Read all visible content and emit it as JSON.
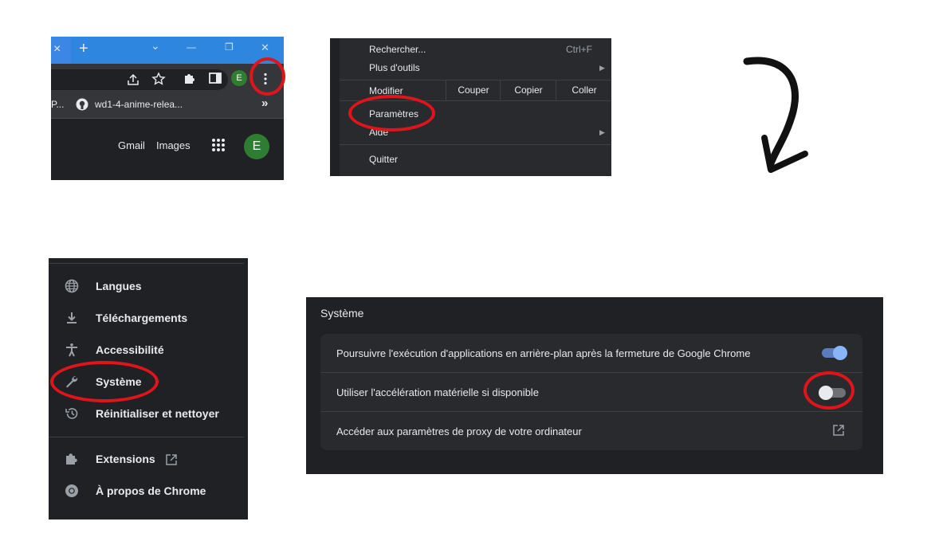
{
  "browser": {
    "tab_close": "×",
    "new_tab": "+",
    "tab_search": "⌄",
    "win_min": "—",
    "win_restore": "❐",
    "win_close": "✕",
    "profile_initial": "E",
    "bookmark_prev": "P...",
    "bookmark_label": "wd1-4-anime-relea...",
    "bookmarks_more": "»",
    "gmail": "Gmail",
    "images": "Images",
    "account_initial": "E"
  },
  "menu": {
    "items": [
      {
        "label": "Rechercher...",
        "shortcut": "Ctrl+F"
      },
      {
        "label": "Plus d'outils"
      },
      {
        "label": "Modifier"
      },
      {
        "label": "Paramètres"
      },
      {
        "label": "Aide"
      },
      {
        "label": "Quitter"
      }
    ],
    "edit_actions": [
      "Couper",
      "Copier",
      "Coller"
    ]
  },
  "settings_nav": {
    "items": [
      {
        "label": "Langues",
        "icon": "globe-icon"
      },
      {
        "label": "Téléchargements",
        "icon": "download-icon"
      },
      {
        "label": "Accessibilité",
        "icon": "accessibility-icon"
      },
      {
        "label": "Système",
        "icon": "wrench-icon"
      },
      {
        "label": "Réinitialiser et nettoyer",
        "icon": "history-icon"
      },
      {
        "label": "Extensions",
        "icon": "puzzle-icon"
      },
      {
        "label": "À propos de Chrome",
        "icon": "chrome-icon"
      }
    ]
  },
  "system": {
    "title": "Système",
    "rows": [
      {
        "label": "Poursuivre l'exécution d'applications en arrière-plan après la fermeture de Google Chrome",
        "toggle_on": true
      },
      {
        "label": "Utiliser l'accélération matérielle si disponible",
        "toggle_on": false
      },
      {
        "label": "Accéder aux paramètres de proxy de votre ordinateur"
      }
    ]
  },
  "colors": {
    "highlight_ring": "#e0141b",
    "toggle_on": "#8ab4f8",
    "toggle_track_on": "#5b7dbb",
    "toggle_off_track": "#6f7074",
    "panel_dark": "#202124"
  }
}
